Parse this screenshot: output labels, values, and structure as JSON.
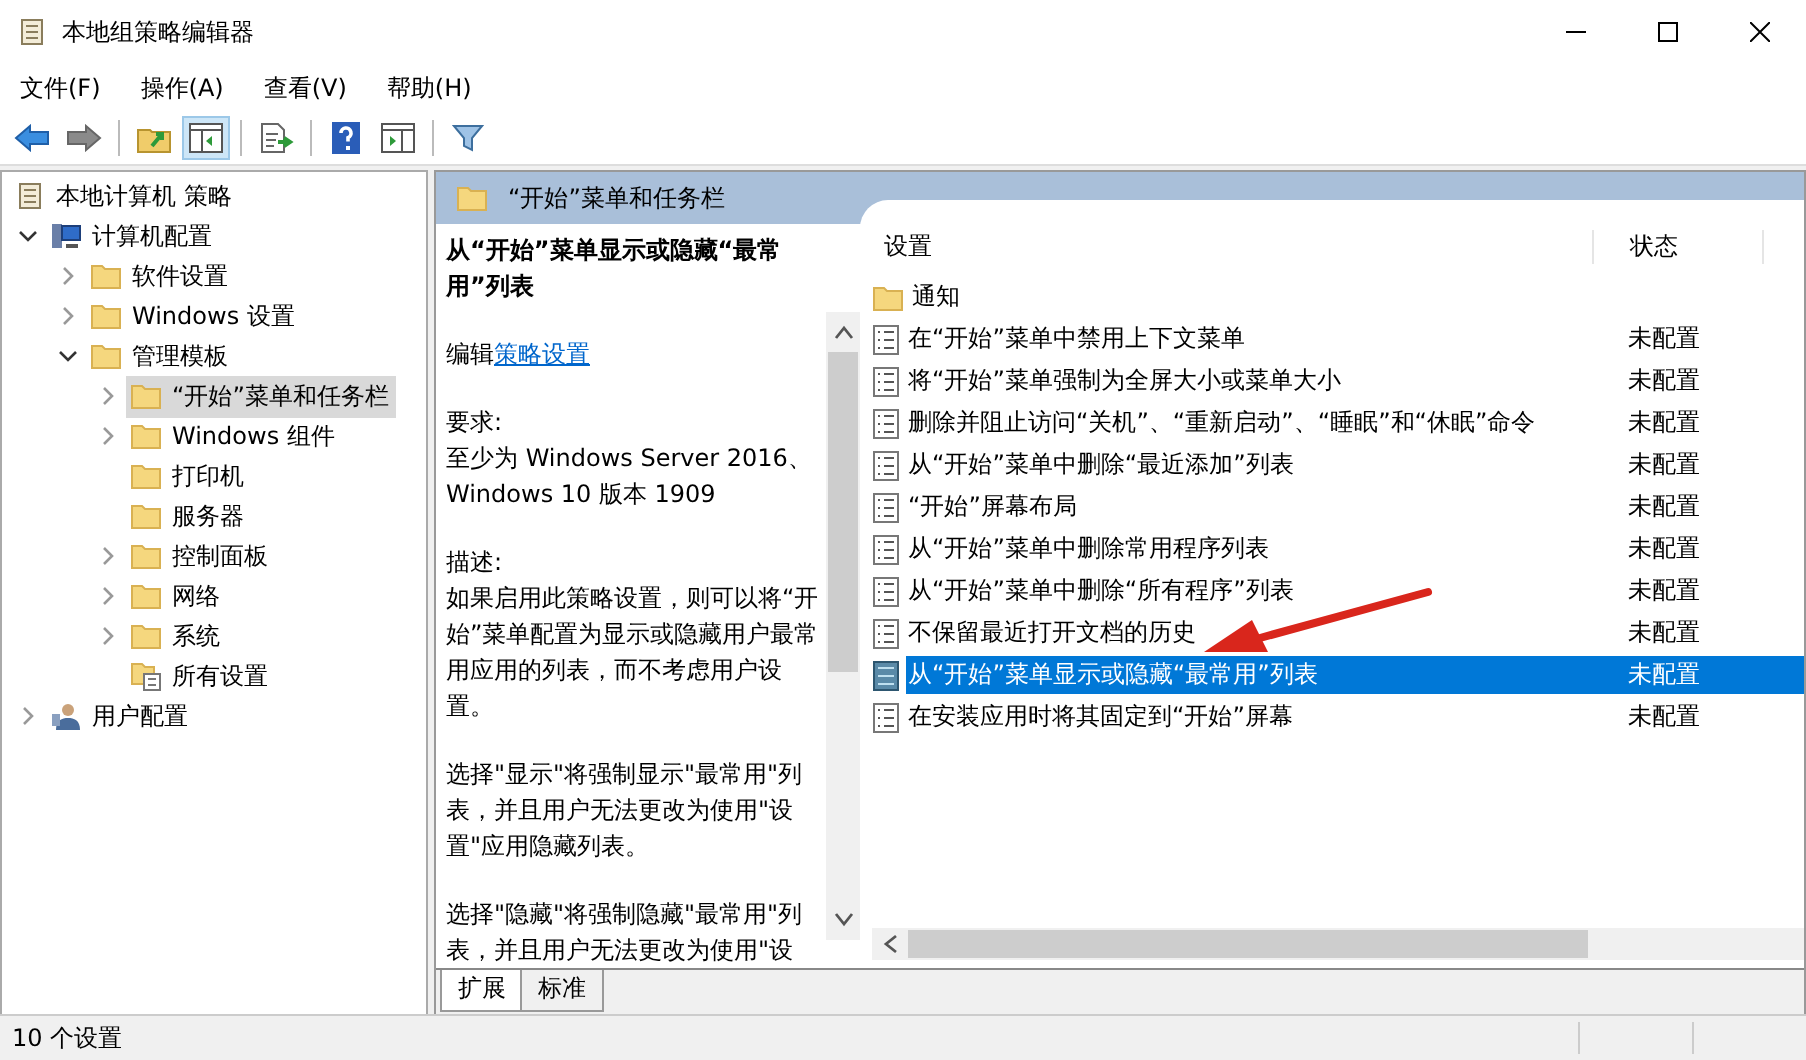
{
  "window": {
    "title": "本地组策略编辑器"
  },
  "menu": [
    "文件(F)",
    "操作(A)",
    "查看(V)",
    "帮助(H)"
  ],
  "toolbar": [
    {
      "kind": "back",
      "pressed": false
    },
    {
      "kind": "forward",
      "pressed": false
    },
    {
      "kind": "up",
      "pressed": false
    },
    {
      "kind": "tree",
      "pressed": true
    },
    {
      "kind": "export",
      "pressed": false
    },
    {
      "kind": "help",
      "pressed": false
    },
    {
      "kind": "view",
      "pressed": false
    },
    {
      "kind": "filter",
      "pressed": false
    }
  ],
  "tree": {
    "label": "本地计算机 策略",
    "kind": "policy",
    "selected": false,
    "children": [
      {
        "label": "计算机配置",
        "kind": "computer",
        "expanded": true,
        "selected": false,
        "children": [
          {
            "label": "软件设置",
            "kind": "folder",
            "expanded": false,
            "selected": false
          },
          {
            "label": "Windows 设置",
            "kind": "folder",
            "expanded": false,
            "selected": false
          },
          {
            "label": "管理模板",
            "kind": "folder",
            "expanded": true,
            "selected": false,
            "children": [
              {
                "label": "“开始”菜单和任务栏",
                "kind": "folder",
                "expanded": false,
                "selected": true
              },
              {
                "label": "Windows 组件",
                "kind": "folder",
                "expanded": false,
                "selected": false
              },
              {
                "label": "打印机",
                "kind": "folder",
                "selected": false
              },
              {
                "label": "服务器",
                "kind": "folder",
                "selected": false
              },
              {
                "label": "控制面板",
                "kind": "folder",
                "expanded": false,
                "selected": false
              },
              {
                "label": "网络",
                "kind": "folder",
                "expanded": false,
                "selected": false
              },
              {
                "label": "系统",
                "kind": "folder",
                "expanded": false,
                "selected": false
              },
              {
                "label": "所有设置",
                "kind": "settings",
                "selected": false
              }
            ]
          }
        ]
      },
      {
        "label": "用户配置",
        "kind": "user",
        "expanded": false,
        "selected": false
      }
    ]
  },
  "category_header": {
    "title": "“开始”菜单和任务栏"
  },
  "detail": {
    "title": "从“开始”菜单显示或隐藏“最常用”列表",
    "edit_prefix": "编辑",
    "edit_link": "策略设置",
    "requirements_label": "要求:",
    "requirements": "至少为 Windows Server 2016、Windows 10 版本 1909",
    "description_label": "描述:",
    "paragraphs": [
      "如果启用此策略设置，则可以将“开始”菜单配置为显示或隐藏用户最常用应用的列表，而不考虑用户设置。",
      "选择\"显示\"将强制显示\"最常用\"列表，并且用户无法更改为使用\"设置\"应用隐藏列表。",
      "选择\"隐藏\"将强制隐藏\"最常用\"列表，并且用户无法更改为使用\"设"
    ]
  },
  "list": {
    "columns": [
      "设置",
      "状态"
    ],
    "rows": [
      {
        "kind": "folder",
        "name": "通知",
        "status": "",
        "selected": false
      },
      {
        "kind": "setting",
        "name": "在“开始”菜单中禁用上下文菜单",
        "status": "未配置",
        "selected": false
      },
      {
        "kind": "setting",
        "name": "将“开始”菜单强制为全屏大小或菜单大小",
        "status": "未配置",
        "selected": false
      },
      {
        "kind": "setting",
        "name": "删除并阻止访问“关机”、“重新启动”、“睡眠”和“休眠”命令",
        "status": "未配置",
        "selected": false
      },
      {
        "kind": "setting",
        "name": "从“开始”菜单中删除“最近添加”列表",
        "status": "未配置",
        "selected": false
      },
      {
        "kind": "setting",
        "name": "“开始”屏幕布局",
        "status": "未配置",
        "selected": false
      },
      {
        "kind": "setting",
        "name": "从“开始”菜单中删除常用程序列表",
        "status": "未配置",
        "selected": false
      },
      {
        "kind": "setting",
        "name": "从“开始”菜单中删除“所有程序”列表",
        "status": "未配置",
        "selected": false
      },
      {
        "kind": "setting",
        "name": "不保留最近打开文档的历史",
        "status": "未配置",
        "selected": false
      },
      {
        "kind": "setting",
        "name": "从“开始”菜单显示或隐藏“最常用”列表",
        "status": "未配置",
        "selected": true
      },
      {
        "kind": "setting",
        "name": "在安装应用时将其固定到“开始”屏幕",
        "status": "未配置",
        "selected": false
      }
    ]
  },
  "view_tabs": [
    {
      "label": "扩展",
      "selected": true
    },
    {
      "label": "标准",
      "selected": false
    }
  ],
  "status_bar": {
    "text": "10 个设置"
  }
}
